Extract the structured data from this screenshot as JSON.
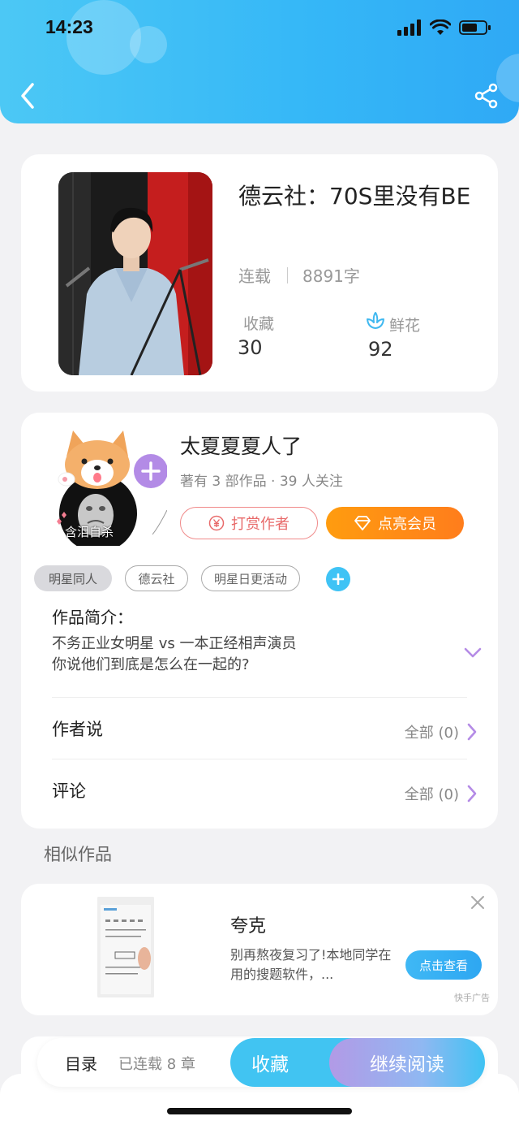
{
  "status_bar": {
    "time": "14:23"
  },
  "book": {
    "title": "德云社：70S里没有BE",
    "status": "连载",
    "word_count": "8891字",
    "favorites_label": "收藏",
    "favorites_count": "30",
    "flowers_label": "鲜花",
    "flowers_count": "92"
  },
  "author": {
    "name": "太夏夏夏人了",
    "info": "著有 3 部作品 · 39 人关注",
    "avatar_caption": "含泪自杀",
    "tip_button": "打赏作者",
    "vip_button": "点亮会员"
  },
  "tags": [
    {
      "label": "明星同人",
      "active": true
    },
    {
      "label": "德云社",
      "active": false
    },
    {
      "label": "明星日更活动",
      "active": false
    }
  ],
  "intro": {
    "title": "作品简介：",
    "line1": "不务正业女明星 vs 一本正经相声演员",
    "line2": "你说他们到底是怎么在一起的?"
  },
  "rows": {
    "author_says_label": "作者说",
    "author_says_value": "全部 (0)",
    "comments_label": "评论",
    "comments_value": "全部 (0)"
  },
  "similar_title": "相似作品",
  "ad": {
    "title": "夸克",
    "text": "别再熬夜复习了!本地同学在用的搜题软件，...",
    "button": "点击查看",
    "source": "快手广告"
  },
  "bottom": {
    "toc": "目录",
    "toc_status": "已连载 8 章",
    "collect": "收藏",
    "read": "继续阅读"
  },
  "colors": {
    "header_blue": "#35b7f7",
    "accent_orange": "#ff8a15",
    "tip_red": "#e86a6a",
    "chevron_purple": "#b48be6"
  },
  "icons": [
    "back-arrow-icon",
    "share-icon",
    "flower-icon",
    "yen-icon",
    "diamond-icon",
    "plus-icon",
    "chevron-down-icon",
    "chevron-right-icon",
    "close-icon"
  ]
}
